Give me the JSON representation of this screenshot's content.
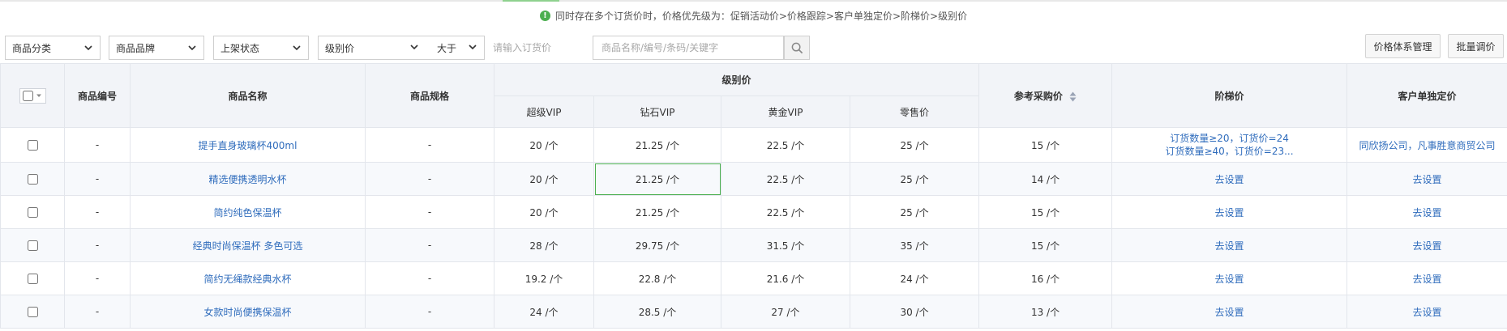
{
  "notice": {
    "text": "同时存在多个订货价时，价格优先级为：促销活动价>价格跟踪>客户单独定价>阶梯价>级别价"
  },
  "filters": {
    "category": "商品分类",
    "brand": "商品品牌",
    "status": "上架状态",
    "price_type": "级别价",
    "operator": "大于",
    "price_placeholder": "请输入订货价",
    "keyword_placeholder": "商品名称/编号/条码/关键字"
  },
  "buttons": {
    "price_system": "价格体系管理",
    "batch_adjust": "批量调价"
  },
  "table": {
    "headers": {
      "code": "商品编号",
      "name": "商品名称",
      "spec": "商品规格",
      "level_price": "级别价",
      "ref_price": "参考采购价",
      "ladder": "阶梯价",
      "customer": "客户单独定价"
    },
    "level_columns": [
      "超级VIP",
      "钻石VIP",
      "黄金VIP",
      "零售价"
    ],
    "rows": [
      {
        "code": "-",
        "name": "提手直身玻璃杯400ml",
        "spec": "-",
        "super_vip": "20 /个",
        "diamond_vip": "21.25 /个",
        "gold_vip": "22.5 /个",
        "retail": "25 /个",
        "ref_price": "15 /个",
        "ladder_line1": "订货数量≥20，订货价=24",
        "ladder_line2": "订货数量≥40，订货价=23...",
        "customer": "同欣扬公司，凡事胜意商贸公司"
      },
      {
        "code": "-",
        "name": "精选便携透明水杯",
        "spec": "-",
        "super_vip": "20 /个",
        "diamond_vip": "21.25 /个",
        "gold_vip": "22.5 /个",
        "retail": "25 /个",
        "ref_price": "14 /个",
        "ladder": "去设置",
        "customer": "去设置"
      },
      {
        "code": "-",
        "name": "简约纯色保温杯",
        "spec": "-",
        "super_vip": "20 /个",
        "diamond_vip": "21.25 /个",
        "gold_vip": "22.5 /个",
        "retail": "25 /个",
        "ref_price": "15 /个",
        "ladder": "去设置",
        "customer": "去设置"
      },
      {
        "code": "-",
        "name": "经典时尚保温杯 多色可选",
        "spec": "-",
        "super_vip": "28 /个",
        "diamond_vip": "29.75 /个",
        "gold_vip": "31.5 /个",
        "retail": "35 /个",
        "ref_price": "15 /个",
        "ladder": "去设置",
        "customer": "去设置"
      },
      {
        "code": "-",
        "name": "简约无绳款经典水杯",
        "spec": "-",
        "super_vip": "19.2 /个",
        "diamond_vip": "22.8 /个",
        "gold_vip": "21.6 /个",
        "retail": "24 /个",
        "ref_price": "16 /个",
        "ladder": "去设置",
        "customer": "去设置"
      },
      {
        "code": "-",
        "name": "女款时尚便携保温杯",
        "spec": "-",
        "super_vip": "24 /个",
        "diamond_vip": "28.5 /个",
        "gold_vip": "27 /个",
        "retail": "30 /个",
        "ref_price": "13 /个",
        "ladder": "去设置",
        "customer": "去设置"
      }
    ]
  },
  "colors": {
    "link": "#2f6cbc",
    "notice_icon": "#4caf50",
    "header_bg": "#f2f4f8"
  }
}
